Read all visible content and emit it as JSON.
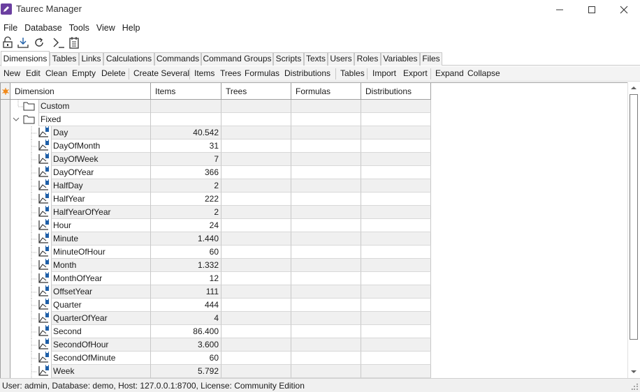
{
  "window": {
    "title": "Taurec Manager",
    "accent_color": "#6b3fa0"
  },
  "menu": [
    "File",
    "Database",
    "Tools",
    "View",
    "Help"
  ],
  "toolbar_icons": [
    "lock-icon",
    "download-icon",
    "refresh-icon",
    "console-icon",
    "notepad-icon"
  ],
  "tabs": [
    "Dimensions",
    "Tables",
    "Links",
    "Calculations",
    "Commands",
    "Command Groups",
    "Scripts",
    "Texts",
    "Users",
    "Roles",
    "Variables",
    "Files"
  ],
  "active_tab": "Dimensions",
  "actions": {
    "group1": [
      "New",
      "Edit",
      "Clean",
      "Empty",
      "Delete"
    ],
    "group2": [
      "Create Several"
    ],
    "group3": [
      "Items",
      "Trees",
      "Formulas",
      "Distributions"
    ],
    "group4": [
      "Tables"
    ],
    "group5": [
      "Import",
      "Export"
    ],
    "group6": [
      "Expand",
      "Collapse"
    ]
  },
  "grid": {
    "columns": [
      "Dimension",
      "Items",
      "Trees",
      "Formulas",
      "Distributions"
    ],
    "folders": [
      "Custom",
      "Fixed"
    ],
    "rows": [
      {
        "name": "Day",
        "items": "40.542"
      },
      {
        "name": "DayOfMonth",
        "items": "31"
      },
      {
        "name": "DayOfWeek",
        "items": "7"
      },
      {
        "name": "DayOfYear",
        "items": "366"
      },
      {
        "name": "HalfDay",
        "items": "2"
      },
      {
        "name": "HalfYear",
        "items": "222"
      },
      {
        "name": "HalfYearOfYear",
        "items": "2"
      },
      {
        "name": "Hour",
        "items": "24"
      },
      {
        "name": "Minute",
        "items": "1.440"
      },
      {
        "name": "MinuteOfHour",
        "items": "60"
      },
      {
        "name": "Month",
        "items": "1.332"
      },
      {
        "name": "MonthOfYear",
        "items": "12"
      },
      {
        "name": "OffsetYear",
        "items": "111"
      },
      {
        "name": "Quarter",
        "items": "444"
      },
      {
        "name": "QuarterOfYear",
        "items": "4"
      },
      {
        "name": "Second",
        "items": "86.400"
      },
      {
        "name": "SecondOfHour",
        "items": "3.600"
      },
      {
        "name": "SecondOfMinute",
        "items": "60"
      },
      {
        "name": "Week",
        "items": "5.792"
      }
    ]
  },
  "status": "User: admin, Database: demo, Host: 127.0.0.1:8700, License: Community Edition"
}
